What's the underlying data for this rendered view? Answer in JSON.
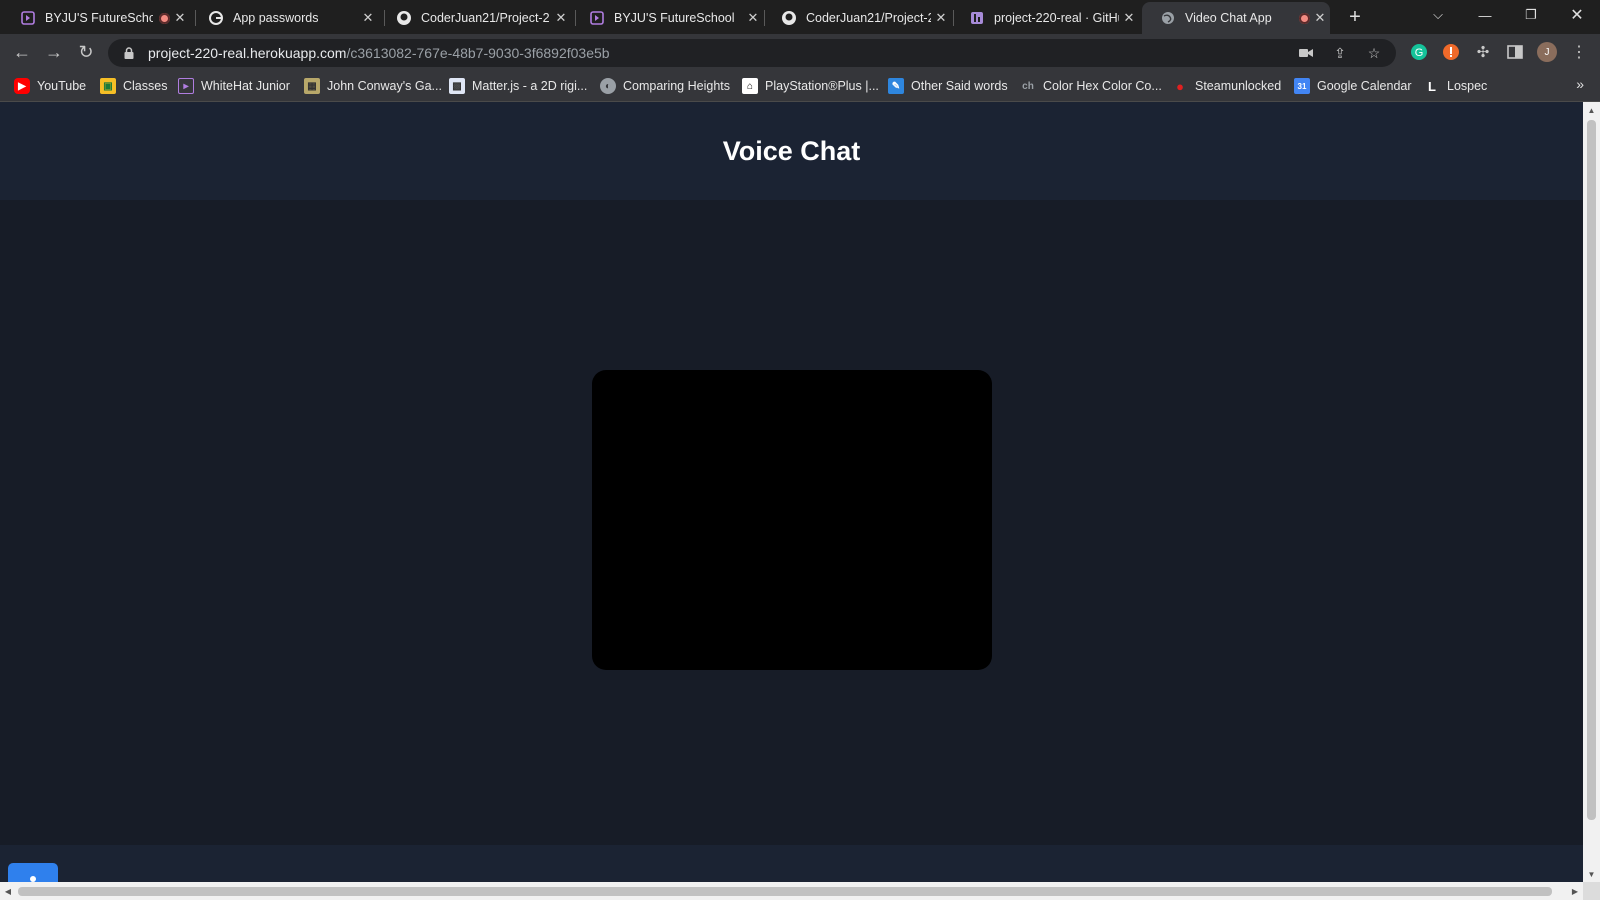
{
  "browser": {
    "tabs": [
      {
        "title": "BYJU'S FutureSchoo",
        "icon": "byjus-icon",
        "recording": true
      },
      {
        "title": "App passwords",
        "icon": "google-icon",
        "recording": false
      },
      {
        "title": "CoderJuan21/Project-2",
        "icon": "github-icon",
        "recording": false
      },
      {
        "title": "BYJU'S FutureSchool",
        "icon": "byjus-icon",
        "recording": false
      },
      {
        "title": "CoderJuan21/Project-2",
        "icon": "github-icon",
        "recording": false
      },
      {
        "title": "project-220-real · GitHu",
        "icon": "heroku-icon",
        "recording": false
      },
      {
        "title": "Video Chat App",
        "icon": "globe-icon",
        "recording": true,
        "active": true
      }
    ],
    "new_tab": "+",
    "url_host": "project-220-real.herokuapp.com",
    "url_path": "/c3613082-767e-48b7-9030-3f6892f03e5b",
    "profile_initial": "J",
    "bookmarks": [
      {
        "label": "YouTube",
        "icon": "youtube-icon"
      },
      {
        "label": "Classes",
        "icon": "classroom-icon"
      },
      {
        "label": "WhiteHat Junior",
        "icon": "whitehat-icon"
      },
      {
        "label": "John Conway's Ga...",
        "icon": "life-icon"
      },
      {
        "label": "Matter.js - a 2D rigi...",
        "icon": "matterjs-icon"
      },
      {
        "label": "Comparing Heights",
        "icon": "globe-icon"
      },
      {
        "label": "PlayStation®Plus |...",
        "icon": "playstation-icon"
      },
      {
        "label": "Other Said words",
        "icon": "said-icon"
      },
      {
        "label": "Color Hex Color Co...",
        "icon": "colorhex-icon"
      },
      {
        "label": "Steamunlocked",
        "icon": "steamunlocked-icon"
      },
      {
        "label": "Google Calendar",
        "icon": "calendar-icon"
      },
      {
        "label": "Lospec",
        "icon": "lospec-icon"
      }
    ]
  },
  "app": {
    "title": "Voice Chat"
  },
  "colors": {
    "page_bg": "#171c27",
    "header_bg": "#1b2333",
    "video_bg": "#000000",
    "fab": "#2f80ed"
  }
}
